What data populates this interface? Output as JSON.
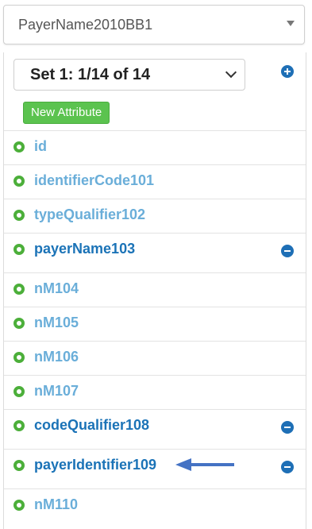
{
  "top_select": {
    "value": "PayerName2010BB1"
  },
  "set_select": {
    "value": "Set 1: 1/14 of 14"
  },
  "new_attribute_label": "New Attribute",
  "items": [
    {
      "label": "id"
    },
    {
      "label": "identifierCode101"
    },
    {
      "label": "typeQualifier102"
    },
    {
      "label": "payerName103"
    },
    {
      "label": "nM104"
    },
    {
      "label": "nM105"
    },
    {
      "label": "nM106"
    },
    {
      "label": "nM107"
    },
    {
      "label": "codeQualifier108"
    },
    {
      "label": "payerIdentifier109"
    },
    {
      "label": "nM110"
    }
  ],
  "colors": {
    "accent_blue": "#1b73b7",
    "light_blue": "#6aaed9",
    "green": "#5bc34f",
    "ring_green": "#4caf3a"
  },
  "icons": {
    "add": "plus-circle-icon",
    "remove": "minus-circle-icon",
    "item": "lifebuoy-icon",
    "arrow": "arrow-left-icon"
  }
}
